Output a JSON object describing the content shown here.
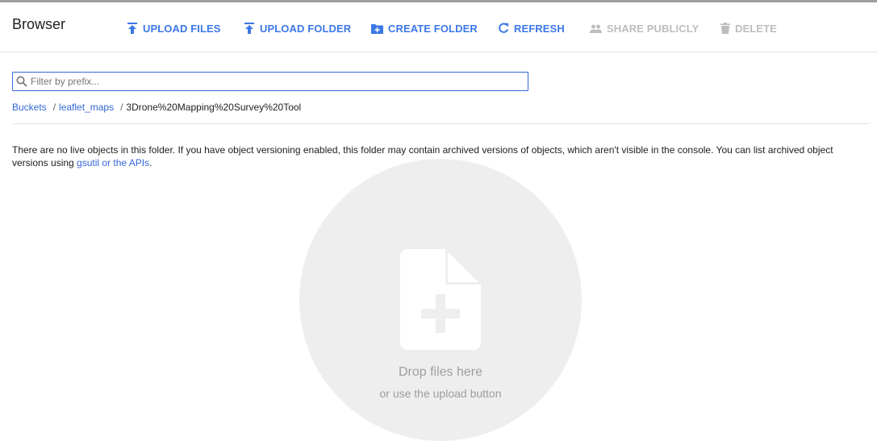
{
  "header": {
    "title": "Browser",
    "actions": {
      "upload_files": "UPLOAD FILES",
      "upload_folder": "UPLOAD FOLDER",
      "create_folder": "CREATE FOLDER",
      "refresh": "REFRESH",
      "share_publicly": "SHARE PUBLICLY",
      "delete": "DELETE"
    }
  },
  "filter": {
    "placeholder": "Filter by prefix...",
    "value": ""
  },
  "breadcrumb": {
    "root": "Buckets",
    "bucket": "leaflet_maps",
    "current": "3Drone%20Mapping%20Survey%20Tool",
    "separator": "/"
  },
  "notice": {
    "text": "There are no live objects in this folder. If you have object versioning enabled, this folder may contain archived versions of objects, which aren't visible in the console. You can list archived object versions using ",
    "link": "gsutil or the APIs",
    "suffix": "."
  },
  "drop_zone": {
    "title": "Drop files here",
    "subtitle": "or use the upload button"
  },
  "colors": {
    "accent": "#3b78e7",
    "link": "#3367d6",
    "disabled": "#bdbdbd",
    "drop_bg": "#eeeeee"
  },
  "icons": {
    "upload_files": "upload-icon",
    "upload_folder": "upload-icon",
    "create_folder": "create-folder-icon",
    "refresh": "refresh-icon",
    "share_publicly": "people-icon",
    "delete": "trash-icon",
    "filter": "search-icon",
    "drop": "file-add-icon"
  }
}
